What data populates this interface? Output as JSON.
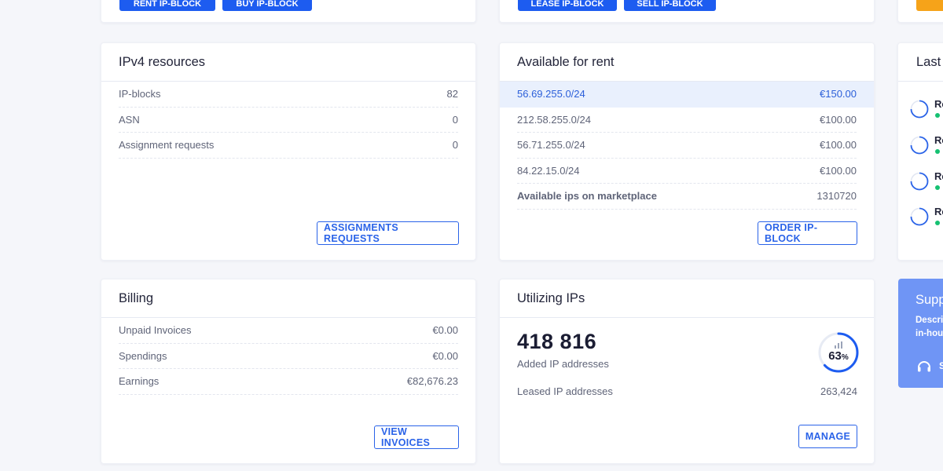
{
  "top_buttons": {
    "rent_ip_block": "RENT IP-BLOCK",
    "buy_ip_block": "BUY IP-BLOCK",
    "lease_ip_block": "LEASE IP-BLOCK",
    "sell_ip_block": "SELL IP-BLOCK"
  },
  "ipv4": {
    "title": "IPv4 resources",
    "rows": [
      {
        "label": "IP-blocks",
        "value": "82"
      },
      {
        "label": "ASN",
        "value": "0"
      },
      {
        "label": "Assignment requests",
        "value": "0"
      }
    ],
    "button": "ASSIGNMENTS REQUESTS"
  },
  "rent": {
    "title": "Available for rent",
    "rows": [
      {
        "label": "56.69.255.0/24",
        "value": "€150.00"
      },
      {
        "label": "212.58.255.0/24",
        "value": "€100.00"
      },
      {
        "label": "56.71.255.0/24",
        "value": "€100.00"
      },
      {
        "label": "84.22.15.0/24",
        "value": "€100.00"
      },
      {
        "label": "Available ips on marketplace",
        "value": "1310720"
      }
    ],
    "button": "ORDER IP-BLOCK"
  },
  "billing": {
    "title": "Billing",
    "rows": [
      {
        "label": "Unpaid Invoices",
        "value": "€0.00"
      },
      {
        "label": "Spendings",
        "value": "€0.00"
      },
      {
        "label": "Earnings",
        "value": "€82,676.23"
      }
    ],
    "button": "VIEW INVOICES"
  },
  "utilizing": {
    "title": "Utilizing IPs",
    "total": "418 816",
    "total_label": "Added IP addresses",
    "percent": 63,
    "percent_text": "63",
    "percent_sign": "%",
    "leased_label": "Leased IP addresses",
    "leased_value": "263,424",
    "button": "MANAGE"
  },
  "last": {
    "title": "Last",
    "items": [
      {
        "text": "Re"
      },
      {
        "text": "Re"
      },
      {
        "text": "Re"
      },
      {
        "text": "Re"
      }
    ]
  },
  "support": {
    "title": "Supp",
    "line1": "Descri",
    "line2": "in-hou",
    "link_initial": "S"
  },
  "colors": {
    "primary": "#1d5cf0",
    "highlight": "#e9f0fd",
    "status_green": "#16c172",
    "support_bg": "#6f95f5",
    "orange": "#f6a319"
  }
}
